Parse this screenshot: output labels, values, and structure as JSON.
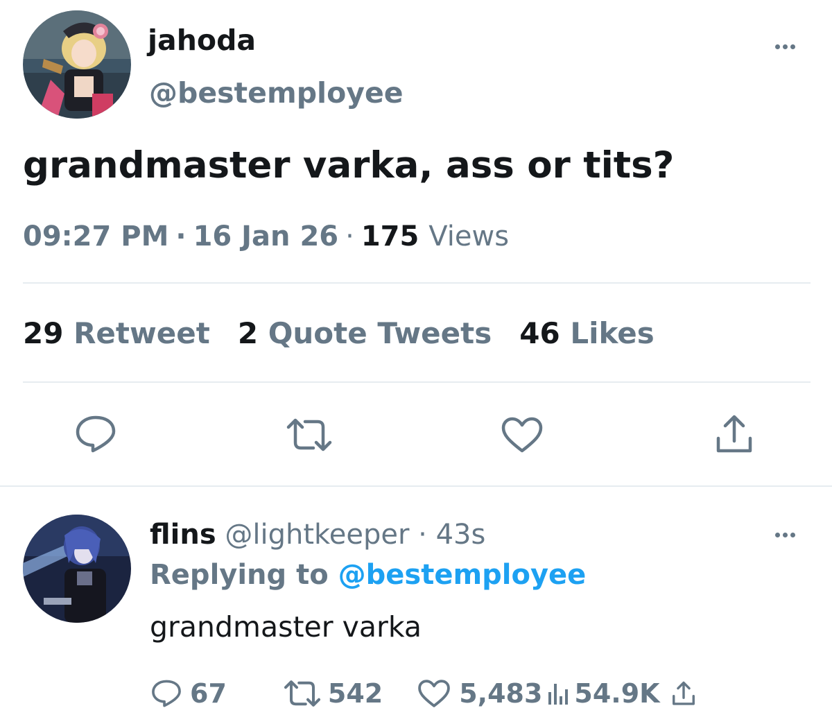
{
  "main_tweet": {
    "display_name": "jahoda",
    "handle": "@bestemployee",
    "text": "grandmaster varka, ass or tits?",
    "time": "09:27 PM",
    "date": "16 Jan 26",
    "views_count": "175",
    "views_label": "Views",
    "separator": "·",
    "stats": {
      "retweets_count": "29",
      "retweets_label": "Retweet",
      "quotes_count": "2",
      "quotes_label": "Quote Tweets",
      "likes_count": "46",
      "likes_label": "Likes"
    },
    "actions": [
      "reply-icon",
      "retweet-icon",
      "like-icon",
      "share-icon"
    ]
  },
  "reply_tweet": {
    "display_name": "flins",
    "handle": "@lightkeeper",
    "separator": "·",
    "time_ago": "43s",
    "replying_prefix": "Replying to",
    "replying_mention": "@bestemployee",
    "text": "grandmaster varka",
    "actions": {
      "replies": "67",
      "retweets": "542",
      "likes": "5,483",
      "views": "54.9K"
    }
  },
  "colors": {
    "primary_text": "#14171a",
    "secondary_text": "#657786",
    "mention": "#1da1f2",
    "divider": "#e6ecf0"
  }
}
